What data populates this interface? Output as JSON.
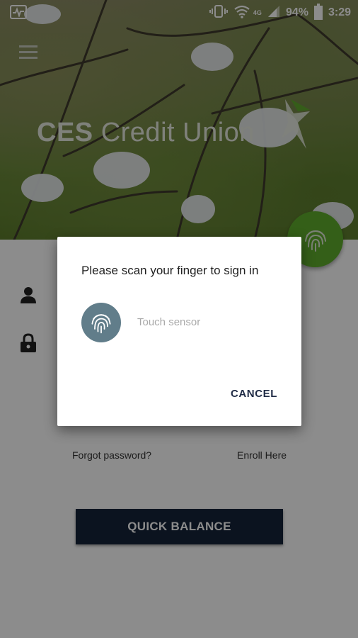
{
  "status_bar": {
    "network_label": "4G",
    "battery": "94%",
    "time": "3:29"
  },
  "app": {
    "brand_bold": "CES",
    "brand_rest": " Credit Union",
    "forgot_password": "Forgot password?",
    "enroll": "Enroll Here",
    "quick_balance": "QUICK BALANCE",
    "accent_color": "#5fae2c",
    "button_color": "#15233a"
  },
  "dialog": {
    "title": "Please scan your finger to sign in",
    "hint": "Touch sensor",
    "cancel": "CANCEL",
    "icon_color": "#617d8a"
  },
  "icons": [
    "menu-icon",
    "user-icon",
    "lock-icon",
    "fingerprint-icon",
    "wifi-icon",
    "signal-icon",
    "vibrate-icon",
    "battery-icon",
    "activity-icon"
  ]
}
